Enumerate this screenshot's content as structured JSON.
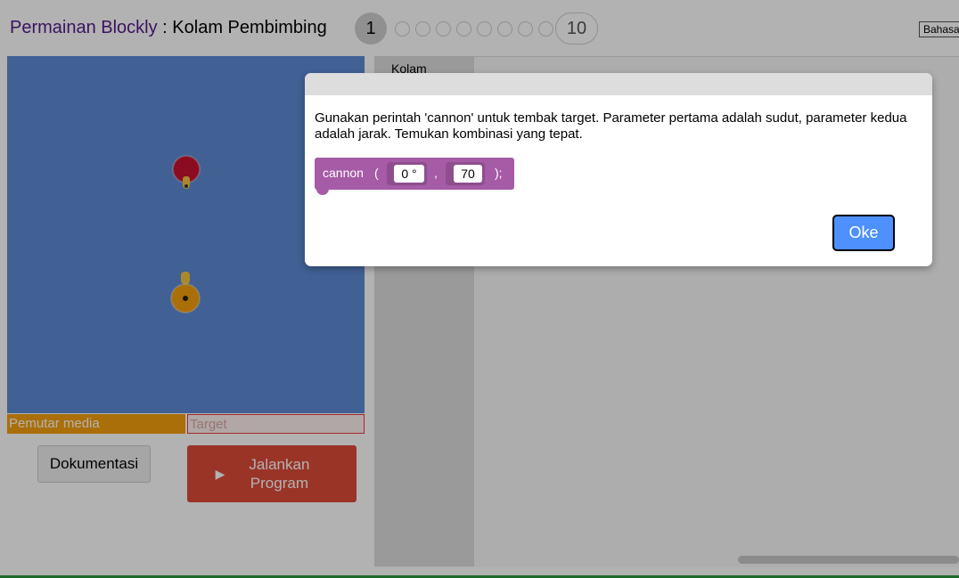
{
  "header": {
    "game_title": "Permainan Blockly",
    "separator": " : ",
    "level_title": "Kolam Pembimbing",
    "current_level": "1",
    "last_level": "10",
    "language": "Bahasa Indonesia"
  },
  "status": {
    "media_label": "Pemutar media",
    "target_label": "Target"
  },
  "buttons": {
    "docs_label": "Dokumentasi",
    "run_icon": "▶",
    "run_label": "Jalankan Program"
  },
  "toolbox": {
    "category": "Kolam"
  },
  "dialog": {
    "text": "Gunakan perintah 'cannon' untuk tembak target. Parameter pertama adalah sudut, parameter kedua adalah jarak. Temukan kombinasi yang tepat.",
    "block": {
      "name": "cannon",
      "open_paren": "(",
      "angle": "0 °",
      "comma": ",",
      "distance": "70",
      "close": ");"
    },
    "ok_label": "Oke"
  },
  "colors": {
    "pond": "#5d8ad3",
    "block": "#a55ba5",
    "run_button": "#dd4b39",
    "ok_button": "#4d90fe",
    "media_bar": "#f4a00e"
  }
}
